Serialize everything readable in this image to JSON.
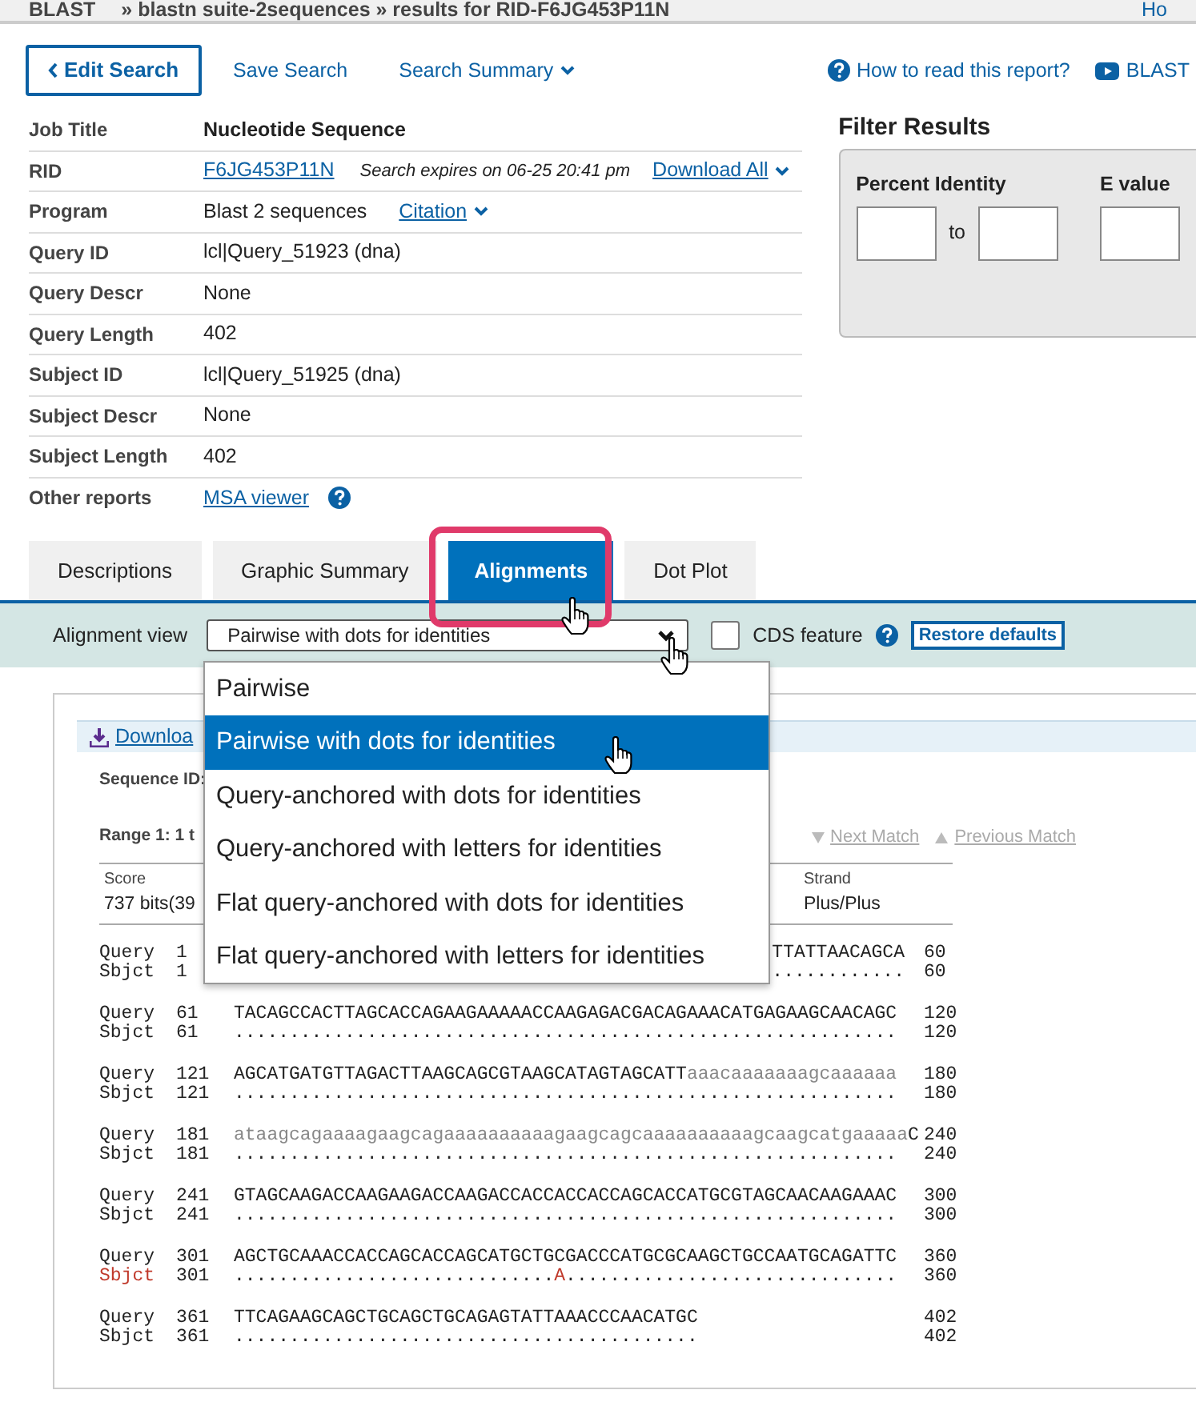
{
  "breadcrumb": {
    "home": "BLAST",
    "path": "» blastn suite-2sequences » results for RID-F6JG453P11N",
    "right_link": "Ho"
  },
  "toolbar": {
    "edit_button": "Edit Search",
    "links": [
      {
        "label": "Save Search",
        "dropdown": false
      },
      {
        "label": "Search Summary",
        "dropdown": true
      }
    ],
    "help_links": [
      {
        "kind": "help",
        "label": "How to read this report?"
      },
      {
        "kind": "video",
        "label": "BLAST"
      }
    ]
  },
  "job_info": [
    {
      "label": "Job Title",
      "kind": "title",
      "value": "Nucleotide Sequence"
    },
    {
      "label": "RID",
      "kind": "rid",
      "value": "F6JG453P11N",
      "note": "Search expires on 06-25 20:41 pm",
      "action": "Download All"
    },
    {
      "label": "Program",
      "kind": "program",
      "value": "Blast 2 sequences",
      "action": "Citation"
    },
    {
      "label": "Query ID",
      "kind": "plain",
      "value": "lcl|Query_51923 (dna)"
    },
    {
      "label": "Query Descr",
      "kind": "plain",
      "value": "None"
    },
    {
      "label": "Query Length",
      "kind": "plain",
      "value": "402"
    },
    {
      "label": "Subject ID",
      "kind": "plain",
      "value": "lcl|Query_51925 (dna)"
    },
    {
      "label": "Subject Descr",
      "kind": "plain",
      "value": "None"
    },
    {
      "label": "Subject Length",
      "kind": "plain",
      "value": "402"
    },
    {
      "label": "Other reports",
      "kind": "link",
      "value": "MSA viewer"
    }
  ],
  "filter": {
    "title": "Filter Results",
    "fields": [
      {
        "label": "Percent Identity",
        "kind": "range",
        "separator": "to"
      },
      {
        "label": "E value",
        "kind": "single"
      }
    ]
  },
  "tabs": [
    {
      "label": "Descriptions",
      "selected": false
    },
    {
      "label": "Graphic Summary",
      "selected": false
    },
    {
      "label": "Alignments",
      "selected": true
    },
    {
      "label": "Dot Plot",
      "selected": false
    }
  ],
  "alignment_view": {
    "label": "Alignment view",
    "value": "Pairwise with dots for identities",
    "cds_label": "CDS feature",
    "cds_checked": false,
    "restore_button": "Restore defaults",
    "options": [
      {
        "label": "Pairwise",
        "selected": false
      },
      {
        "label": "Pairwise with dots for identities",
        "selected": true
      },
      {
        "label": "Query-anchored with dots for identities",
        "selected": false
      },
      {
        "label": "Query-anchored with letters for identities",
        "selected": false
      },
      {
        "label": "Flat query-anchored with dots for identities",
        "selected": false
      },
      {
        "label": "Flat query-anchored with letters for identities",
        "selected": false
      }
    ]
  },
  "results": {
    "download": "Downloa",
    "sequence_id": "Sequence ID:",
    "range": "Range 1: 1 t",
    "next_match": "Next Match",
    "previous_match": "Previous Match",
    "score_header": "Score",
    "score_value": "737 bits(39",
    "strand_header": "Strand",
    "strand_value": "Plus/Plus",
    "blocks": [
      {
        "clipped": true,
        "query": {
          "label": "Query",
          "start": "1",
          "end": "60",
          "segments": [
            {
              "text": "TTATTAACAGCA",
              "masked": false
            }
          ]
        },
        "sbjct": {
          "label": "Sbjct",
          "start": "1",
          "end": "60",
          "mismatch": false,
          "segments": [
            {
              "text": "............",
              "mismatch": false
            }
          ]
        }
      },
      {
        "clipped": false,
        "query": {
          "label": "Query",
          "start": "61",
          "end": "120",
          "segments": [
            {
              "text": "TACAGCCACTTAGCACCAGAAGAAAAACCAAGAGACGACAGAAACATGAGAAGCAACAGC",
              "masked": false
            }
          ]
        },
        "sbjct": {
          "label": "Sbjct",
          "start": "61",
          "end": "120",
          "mismatch": false,
          "segments": [
            {
              "text": "............................................................",
              "mismatch": false
            }
          ]
        }
      },
      {
        "clipped": false,
        "query": {
          "label": "Query",
          "start": "121",
          "end": "180",
          "segments": [
            {
              "text": "AGCATGATGTTAGACTTAAGCAGCGTAAGCATAGTAGCATT",
              "masked": false
            },
            {
              "text": "aaacaaaaaaagcaaaaaa",
              "masked": true
            }
          ]
        },
        "sbjct": {
          "label": "Sbjct",
          "start": "121",
          "end": "180",
          "mismatch": false,
          "segments": [
            {
              "text": "............................................................",
              "mismatch": false
            }
          ]
        }
      },
      {
        "clipped": false,
        "query": {
          "label": "Query",
          "start": "181",
          "end": "240",
          "segments": [
            {
              "text": "ataagcagaaaagaagcagaaaaaaaaaagaagcagcaaaaaaaaaagcaagcatgaaaaa",
              "masked": true
            },
            {
              "text": "C",
              "masked": false
            }
          ]
        },
        "sbjct": {
          "label": "Sbjct",
          "start": "181",
          "end": "240",
          "mismatch": false,
          "segments": [
            {
              "text": "............................................................",
              "mismatch": false
            }
          ]
        }
      },
      {
        "clipped": false,
        "query": {
          "label": "Query",
          "start": "241",
          "end": "300",
          "segments": [
            {
              "text": "GTAGCAAGACCAAGAAGACCAAGACCACCACCACCAGCACCATGCGTAGCAACAAGAAAC",
              "masked": false
            }
          ]
        },
        "sbjct": {
          "label": "Sbjct",
          "start": "241",
          "end": "300",
          "mismatch": false,
          "segments": [
            {
              "text": "............................................................",
              "mismatch": false
            }
          ]
        }
      },
      {
        "clipped": false,
        "query": {
          "label": "Query",
          "start": "301",
          "end": "360",
          "segments": [
            {
              "text": "AGCTGCAAACCACCAGCACCAGCATGCTGCGACCCATGCGCAAGCTGCCAATGCAGATTC",
              "masked": false
            }
          ]
        },
        "sbjct": {
          "label": "Sbjct",
          "start": "301",
          "end": "360",
          "mismatch": true,
          "segments": [
            {
              "text": ".............................",
              "mismatch": false
            },
            {
              "text": "A",
              "mismatch": true
            },
            {
              "text": "..............................",
              "mismatch": false
            }
          ]
        }
      },
      {
        "clipped": false,
        "query": {
          "label": "Query",
          "start": "361",
          "end": "402",
          "segments": [
            {
              "text": "TTCAGAAGCAGCTGCAGCTGCAGAGTATTAAACCCAACATGC",
              "masked": false
            }
          ]
        },
        "sbjct": {
          "label": "Sbjct",
          "start": "361",
          "end": "402",
          "mismatch": false,
          "segments": [
            {
              "text": "..........................................",
              "mismatch": false
            }
          ]
        }
      }
    ]
  }
}
